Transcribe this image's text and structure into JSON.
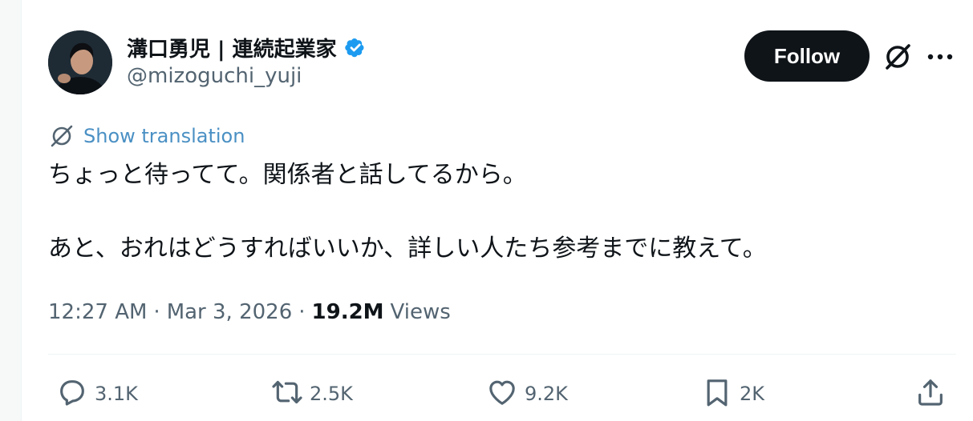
{
  "author": {
    "display_name": "溝口勇児 | 連続起業家",
    "handle": "@mizoguchi_yuji",
    "verified_color": "#1d9bf0"
  },
  "header": {
    "follow_label": "Follow",
    "grok_icon": "grok-icon",
    "more_icon": "more-icon"
  },
  "translation": {
    "label": "Show translation",
    "color": "#4a90c4"
  },
  "tweet": {
    "line1": "ちょっと待ってて。関係者と話してるから。",
    "line2": "あと、おれはどうすればいいか、詳しい人たち参考までに教えて。"
  },
  "meta": {
    "time": "12:27 AM",
    "separator": "·",
    "date": "Mar 3, 2026",
    "views_count": "19.2M",
    "views_label": "Views"
  },
  "actions": {
    "reply": {
      "icon": "reply-icon",
      "count": "3.1K"
    },
    "retweet": {
      "icon": "retweet-icon",
      "count": "2.5K"
    },
    "like": {
      "icon": "heart-icon",
      "count": "9.2K"
    },
    "bookmark": {
      "icon": "bookmark-icon",
      "count": "2K"
    },
    "share": {
      "icon": "share-icon"
    }
  },
  "colors": {
    "text_primary": "#0f1419",
    "text_secondary": "#536471",
    "follow_bg": "#0f1419"
  }
}
